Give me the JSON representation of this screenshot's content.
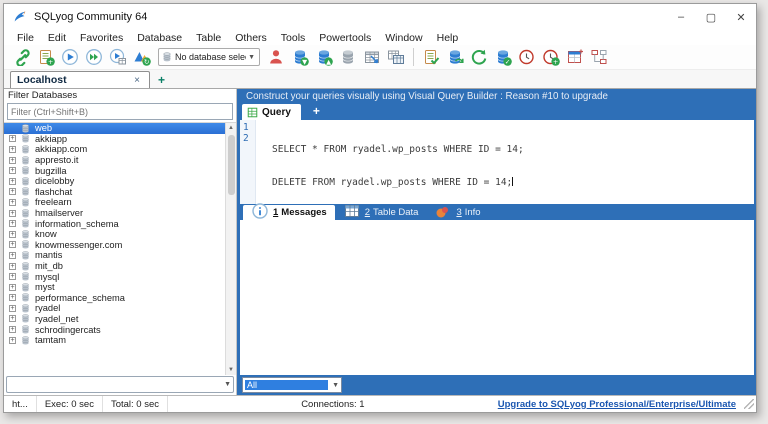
{
  "colors": {
    "bar_blue": "#2e6fb7",
    "selection_blue": "#2f7fe0",
    "keyword_blue": "#3f48cc",
    "link_blue": "#1a56b0",
    "green": "#2ea44f",
    "db_blue": "#2d7dd2",
    "person_red": "#d9534f"
  },
  "window": {
    "title": "SQLyog Community 64",
    "minimize_glyph": "–",
    "maximize_glyph": "▢",
    "close_glyph": "✕"
  },
  "menu": {
    "items": [
      {
        "label": "File"
      },
      {
        "label": "Edit"
      },
      {
        "label": "Favorites"
      },
      {
        "label": "Database"
      },
      {
        "label": "Table"
      },
      {
        "label": "Others"
      },
      {
        "label": "Tools"
      },
      {
        "label": "Powertools"
      },
      {
        "label": "Window"
      },
      {
        "label": "Help"
      }
    ]
  },
  "toolbar": {
    "left_icons": [
      {
        "name": "new-connection-icon",
        "shape": "link"
      },
      {
        "name": "new-query-editor-icon",
        "shape": "doc-plus"
      },
      {
        "name": "execute-query-icon",
        "shape": "play"
      },
      {
        "name": "execute-all-queries-icon",
        "shape": "ff"
      },
      {
        "name": "execute-for-edit-icon",
        "shape": "play-grid"
      },
      {
        "name": "visual-data-compare-icon",
        "shape": "mountain"
      }
    ],
    "database_selector": {
      "value": "No database selected",
      "chevron": "▼"
    },
    "right_icons": [
      {
        "name": "user-manager-icon",
        "shape": "person"
      },
      {
        "name": "import-database-icon",
        "shape": "db-down"
      },
      {
        "name": "export-database-icon",
        "shape": "db-up"
      },
      {
        "name": "database-stack-icon",
        "shape": "db-gray"
      },
      {
        "name": "copy-table-icon",
        "shape": "grid-arrow"
      },
      {
        "name": "copy-database-icon",
        "shape": "grid-grid"
      },
      {
        "name": "toolbar-separator",
        "shape": "sep",
        "sep": true
      },
      {
        "name": "query-formatter-icon",
        "shape": "doc-check"
      },
      {
        "name": "sync-database-icon",
        "shape": "db-sync"
      },
      {
        "name": "refresh-icon",
        "shape": "refresh"
      },
      {
        "name": "backup-database-icon",
        "shape": "db-check"
      },
      {
        "name": "history-icon",
        "shape": "clock"
      },
      {
        "name": "scheduled-backup-icon",
        "shape": "clock-plus"
      },
      {
        "name": "table-window-icon",
        "shape": "window-grid"
      },
      {
        "name": "schema-designer-icon",
        "shape": "flow"
      }
    ]
  },
  "connection_tabs": {
    "tabs": [
      {
        "label": "Localhost"
      }
    ],
    "close_glyph": "×",
    "add_glyph": "+"
  },
  "sidebar": {
    "header": "Filter Databases",
    "filter_placeholder": "Filter (Ctrl+Shift+B)",
    "scroll_up_glyph": "▲",
    "scroll_down_glyph": "▼",
    "combo_chevron": "▼",
    "combo_value": "",
    "databases": [
      {
        "name": "web",
        "selected": true
      },
      {
        "name": "akkiapp"
      },
      {
        "name": "akkiapp.com"
      },
      {
        "name": "appresto.it"
      },
      {
        "name": "bugzilla"
      },
      {
        "name": "dicelobby"
      },
      {
        "name": "flashchat"
      },
      {
        "name": "freelearn"
      },
      {
        "name": "hmailserver"
      },
      {
        "name": "information_schema"
      },
      {
        "name": "know"
      },
      {
        "name": "knowmessenger.com"
      },
      {
        "name": "mantis"
      },
      {
        "name": "mit_db"
      },
      {
        "name": "mysql"
      },
      {
        "name": "myst"
      },
      {
        "name": "performance_schema"
      },
      {
        "name": "ryadel"
      },
      {
        "name": "ryadel_net"
      },
      {
        "name": "schrodingercats"
      },
      {
        "name": "tamtam"
      }
    ]
  },
  "banner": {
    "text": "Construct your queries visually using Visual Query Builder : Reason #10 to upgrade"
  },
  "query_tabs": {
    "active_label": "Query",
    "add_glyph": "+"
  },
  "editor": {
    "lines": [
      {
        "num": "1",
        "tokens": [
          {
            "t": "SELECT",
            "k": true
          },
          {
            "t": " * "
          },
          {
            "t": "FROM",
            "k": true
          },
          {
            "t": " ryadel.wp_posts "
          },
          {
            "t": "WHERE",
            "k": true
          },
          {
            "t": " ID = 14;"
          }
        ]
      },
      {
        "num": "2",
        "tokens": [
          {
            "t": "DELETE",
            "k": true
          },
          {
            "t": " "
          },
          {
            "t": "FROM",
            "k": true
          },
          {
            "t": " ryadel.wp_posts "
          },
          {
            "t": "WHERE",
            "k": true
          },
          {
            "t": " ID = 14;"
          }
        ]
      }
    ]
  },
  "results_tabs": [
    {
      "num": "1",
      "label": "Messages",
      "icon": "info",
      "active": true
    },
    {
      "num": "2",
      "label": "Table Data",
      "icon": "grid-blue"
    },
    {
      "num": "3",
      "label": "Info",
      "icon": "dot-orange"
    }
  ],
  "bottom_bar": {
    "filter_value": "All",
    "chevron": "▼"
  },
  "statusbar": {
    "left": "ht...",
    "exec": "Exec: 0 sec",
    "total": "Total: 0 sec",
    "connections": "Connections: 1",
    "upgrade_link": "Upgrade to SQLyog Professional/Enterprise/Ultimate"
  }
}
